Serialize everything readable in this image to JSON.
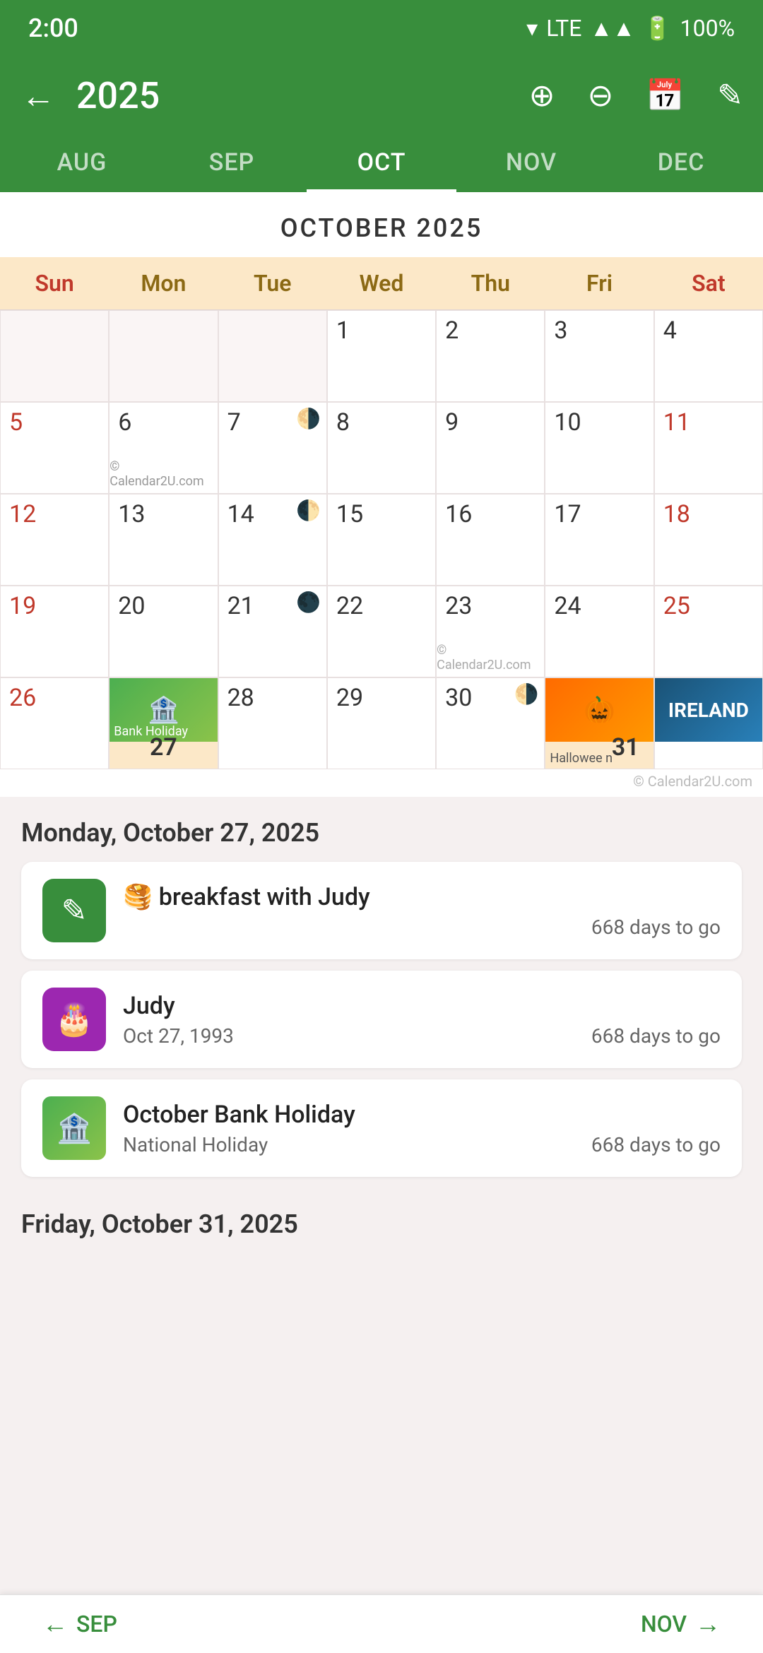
{
  "statusBar": {
    "time": "2:00",
    "icons": "▾ LTE▲▲ 🔋 100%"
  },
  "toolbar": {
    "year": "2025",
    "backLabel": "←",
    "zoomInLabel": "⊕",
    "zoomOutLabel": "⊖",
    "calendarLabel": "📅",
    "editLabel": "✏"
  },
  "monthTabs": [
    {
      "label": "AUG",
      "active": false
    },
    {
      "label": "SEP",
      "active": false
    },
    {
      "label": "OCT",
      "active": true
    },
    {
      "label": "NOV",
      "active": false
    },
    {
      "label": "DEC",
      "active": false
    }
  ],
  "calendar": {
    "title": "OCTOBER 2025",
    "dayHeaders": [
      {
        "label": "Sun",
        "type": "weekend"
      },
      {
        "label": "Mon",
        "type": "weekday"
      },
      {
        "label": "Tue",
        "type": "weekday"
      },
      {
        "label": "Wed",
        "type": "weekday"
      },
      {
        "label": "Thu",
        "type": "weekday"
      },
      {
        "label": "Fri",
        "type": "weekday"
      },
      {
        "label": "Sat",
        "type": "weekend"
      }
    ],
    "watermark1": "© Calendar2U.com",
    "watermark2": "© Calendar2U.com"
  },
  "selectedDate": {
    "label": "Monday, October 27, 2025",
    "events": [
      {
        "icon": "📝",
        "iconBg": "green",
        "title": "🥞 breakfast with Judy",
        "sub": "",
        "daysToGo": "668 days to go"
      },
      {
        "icon": "🎂",
        "iconBg": "purple",
        "title": "Judy",
        "sub": "Oct 27, 1993",
        "daysToGo": "668 days to go"
      },
      {
        "icon": "🏦",
        "iconBg": "bank",
        "title": "October Bank Holiday",
        "sub": "National Holiday",
        "daysToGo": "668 days to go"
      }
    ]
  },
  "bottomNav": {
    "prevLabel": "SEP",
    "nextLabel": "NOV",
    "hint": "Friday, October 31, 2025"
  }
}
